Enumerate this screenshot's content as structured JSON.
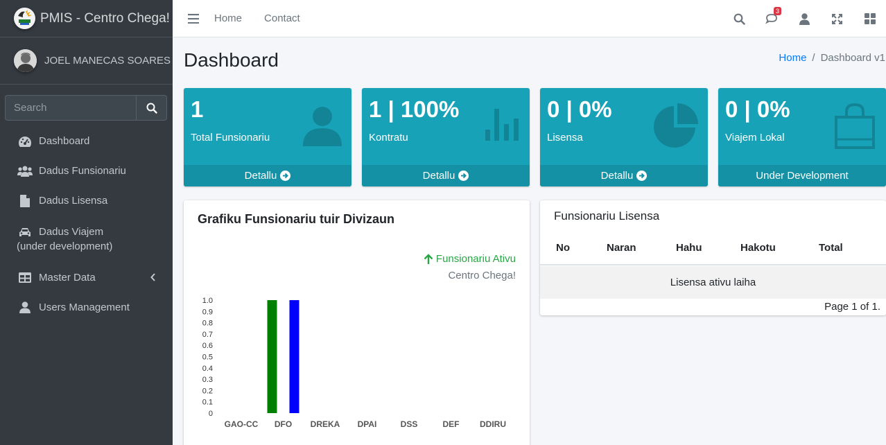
{
  "brand": {
    "title": "PMIS - Centro Chega!"
  },
  "user": {
    "name": "JOEL MANECAS SOARES"
  },
  "sidebar": {
    "search_placeholder": "Search",
    "items": [
      {
        "label": "Dashboard",
        "icon": "tachometer-icon"
      },
      {
        "label": "Dadus Funsionariu",
        "icon": "users-icon"
      },
      {
        "label": "Dadus Lisensa",
        "icon": "file-icon"
      },
      {
        "label": "Dadus Viajem",
        "label2": "(under development)",
        "icon": "car-icon"
      },
      {
        "label": "Master Data",
        "icon": "table-icon"
      },
      {
        "label": "Users Management",
        "icon": "user-icon"
      }
    ]
  },
  "topbar": {
    "links": [
      "Home",
      "Contact"
    ],
    "notification_count": "3"
  },
  "header": {
    "title": "Dashboard",
    "breadcrumb_home": "Home",
    "breadcrumb_current": "Dashboard v1"
  },
  "stat_boxes": [
    {
      "value": "1",
      "label": "Total Funsionariu",
      "footer": "Detallu",
      "icon": "user-icon"
    },
    {
      "value": "1 | 100%",
      "label": "Kontratu",
      "footer": "Detallu",
      "icon": "bar-chart-icon"
    },
    {
      "value": "0 | 0%",
      "label": "Lisensa",
      "footer": "Detallu",
      "icon": "pie-chart-icon"
    },
    {
      "value": "0 | 0%",
      "label": "Viajem Lokal",
      "footer": "Under Development",
      "icon": "shopping-bag-icon"
    }
  ],
  "chart_card": {
    "title": "Grafiku Funsionariu tuir Divizaun",
    "legend_active": "Funsionariu Ativu",
    "legend_org": "Centro Chega!"
  },
  "chart_data": {
    "type": "bar",
    "categories": [
      "GAO-CC",
      "DFO",
      "DREKA",
      "DPAI",
      "DSS",
      "DEF",
      "DDIRU"
    ],
    "values": [
      0,
      1,
      0,
      0,
      0,
      0,
      0
    ],
    "secondary_values": [
      0,
      1,
      0,
      0,
      0,
      0,
      0
    ],
    "colors": [
      "#008000",
      "#0000ff"
    ],
    "ylim": [
      0,
      1.0
    ],
    "yticks": [
      "1.0",
      "0.9",
      "0.8",
      "0.7",
      "0.6",
      "0.5",
      "0.4",
      "0.3",
      "0.2",
      "0.1",
      "0"
    ]
  },
  "table_card": {
    "title": "Funsionariu Lisensa",
    "columns": [
      "No",
      "Naran",
      "Hahu",
      "Hakotu",
      "Total"
    ],
    "empty_text": "Lisensa ativu laiha",
    "page_text": "Page 1 of 1."
  }
}
